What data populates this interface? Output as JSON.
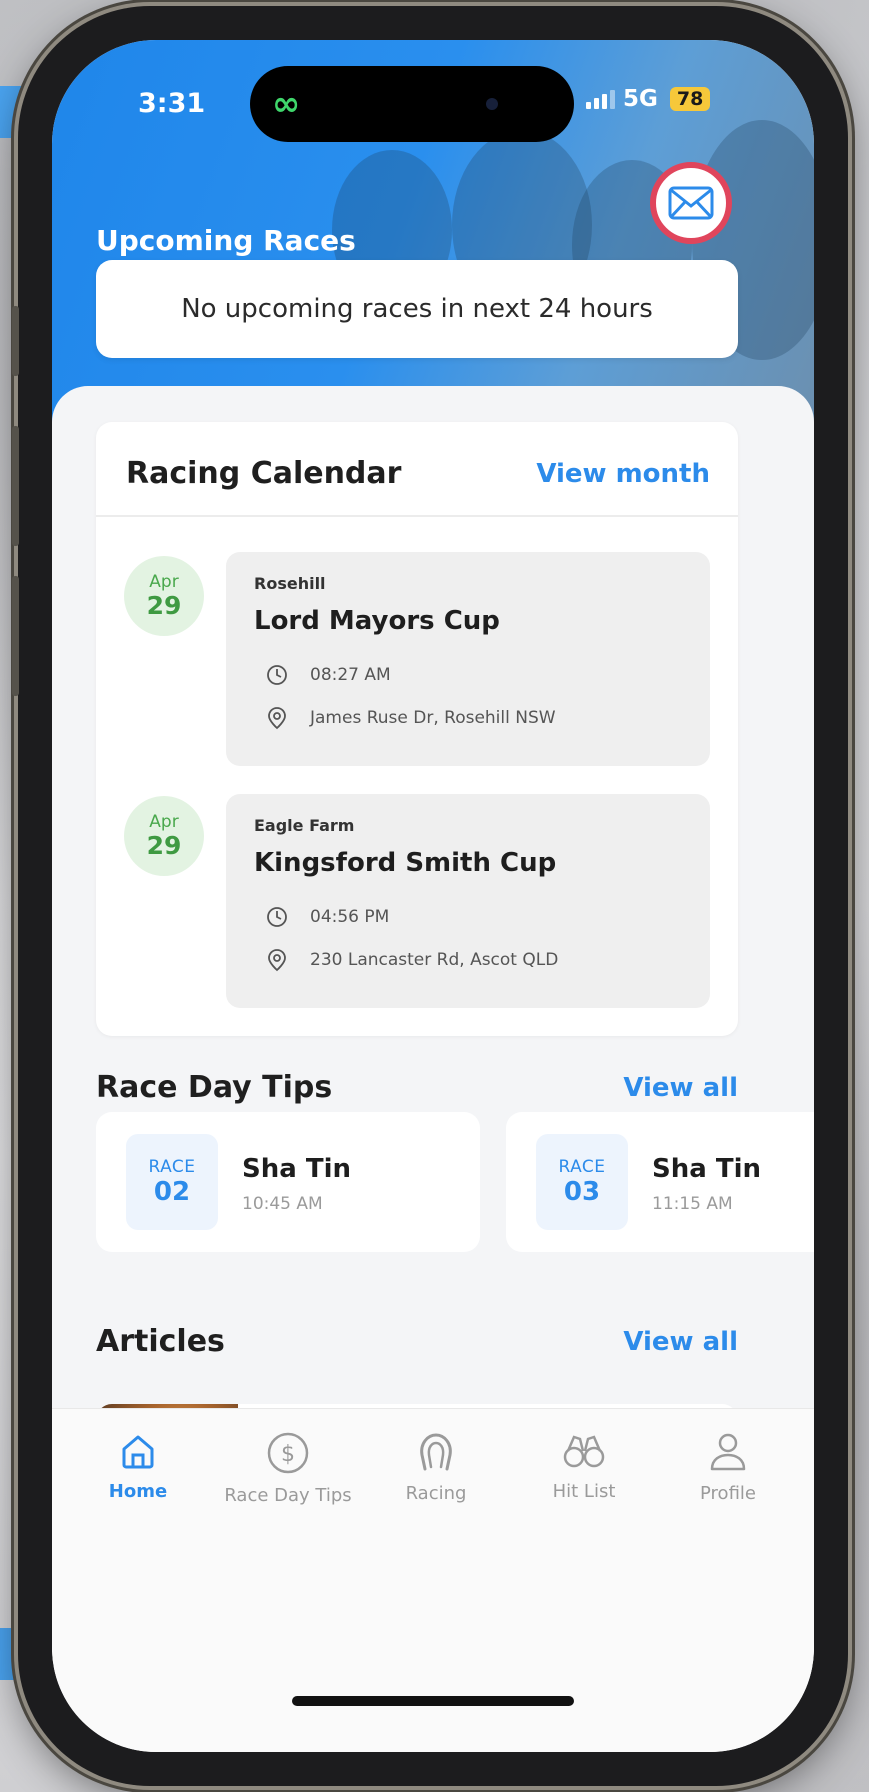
{
  "status_bar": {
    "time": "3:31",
    "network": "5G",
    "battery": "78"
  },
  "header": {
    "title": "Upcoming Races",
    "notice": "No upcoming races in next 24 hours"
  },
  "calendar": {
    "title": "Racing Calendar",
    "view_link": "View month",
    "events": [
      {
        "month": "Apr",
        "day": "29",
        "venue": "Rosehill",
        "name": "Lord Mayors Cup",
        "time": "08:27 AM",
        "address": "James Ruse Dr, Rosehill NSW"
      },
      {
        "month": "Apr",
        "day": "29",
        "venue": "Eagle Farm",
        "name": "Kingsford Smith Cup",
        "time": "04:56 PM",
        "address": "230 Lancaster Rd, Ascot QLD"
      }
    ]
  },
  "tips": {
    "title": "Race Day Tips",
    "view_link": "View all",
    "items": [
      {
        "label": "RACE",
        "number": "02",
        "venue": "Sha Tin",
        "time": "10:45 AM"
      },
      {
        "label": "RACE",
        "number": "03",
        "venue": "Sha Tin",
        "time": "11:15 AM"
      }
    ]
  },
  "articles": {
    "title": "Articles",
    "view_link": "View all"
  },
  "tabbar": {
    "items": [
      {
        "label": "Home",
        "icon": "home-icon"
      },
      {
        "label": "Race Day Tips",
        "icon": "dollar-icon"
      },
      {
        "label": "Racing",
        "icon": "horseshoe-icon"
      },
      {
        "label": "Hit List",
        "icon": "binoculars-icon"
      },
      {
        "label": "Profile",
        "icon": "user-icon"
      }
    ]
  },
  "colors": {
    "accent": "#2c8bea",
    "date_green": "#3f9a42",
    "mail_ring": "#e0455c"
  }
}
